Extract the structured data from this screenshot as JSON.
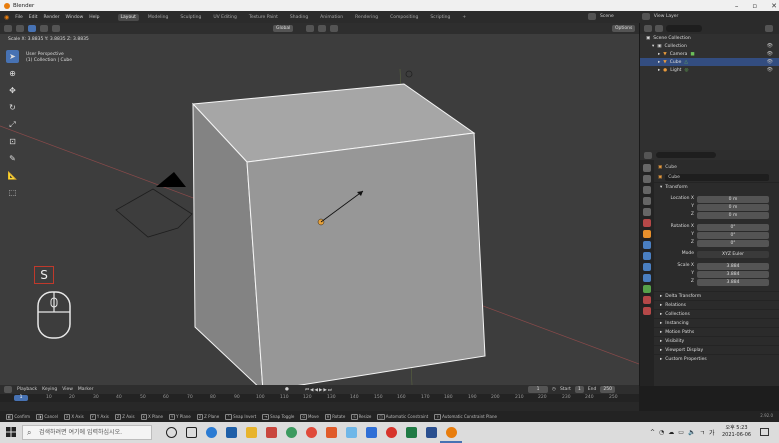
{
  "window": {
    "title": "Blender"
  },
  "menubar": {
    "menus": [
      "File",
      "Edit",
      "Render",
      "Window",
      "Help"
    ],
    "workspaces": [
      "Layout",
      "Modeling",
      "Sculpting",
      "UV Editing",
      "Texture Paint",
      "Shading",
      "Animation",
      "Rendering",
      "Compositing",
      "Scripting"
    ],
    "add_tab": "+",
    "scene_label": "Scene",
    "view_layer_label": "View Layer"
  },
  "viewport": {
    "header": {
      "transform_orientation": "Global",
      "options_label": "Options"
    },
    "operator_info": "Scale X: 3.8835  Y: 3.8835  Z: 3.8835",
    "view_name": "User Perspective",
    "collection_info": "(1) Collection | Cube",
    "key_overlay": "S"
  },
  "outliner": {
    "items": [
      {
        "label": "Scene Collection",
        "level": 0
      },
      {
        "label": "Collection",
        "level": 1
      },
      {
        "label": "Camera",
        "level": 2
      },
      {
        "label": "Cube",
        "level": 2
      },
      {
        "label": "Light",
        "level": 2
      }
    ]
  },
  "properties": {
    "object_name": "Cube",
    "object_field": "Cube",
    "transform_header": "Transform",
    "location": {
      "label": "Location X",
      "x": "0 m",
      "y": "0 m",
      "z": "0 m"
    },
    "rotation": {
      "label": "Rotation X",
      "x": "0°",
      "y": "0°",
      "z": "0°"
    },
    "mode": {
      "label": "Mode",
      "value": "XYZ Euler"
    },
    "scale": {
      "label": "Scale X",
      "x": "3.884",
      "y": "3.884",
      "z": "3.884"
    },
    "axis_labels": {
      "y": "Y",
      "z": "Z"
    },
    "panels": [
      "Delta Transform",
      "Relations",
      "Collections",
      "Instancing",
      "Motion Paths",
      "Visibility",
      "Viewport Display",
      "Custom Properties"
    ]
  },
  "timeline": {
    "menus": [
      "Playback",
      "Keying",
      "View",
      "Marker"
    ],
    "current_frame": "1",
    "start_label": "Start",
    "start": "1",
    "end_label": "End",
    "end": "250",
    "ruler": [
      "10",
      "20",
      "30",
      "40",
      "50",
      "60",
      "70",
      "80",
      "90",
      "100",
      "110",
      "120",
      "130",
      "140",
      "150",
      "160",
      "170",
      "180",
      "190",
      "200",
      "210",
      "220",
      "230",
      "240",
      "250"
    ]
  },
  "statusbar": {
    "items": [
      {
        "key": "",
        "label": "Confirm"
      },
      {
        "key": "",
        "label": "Cancel"
      },
      {
        "key": "X",
        "label": "X Axis"
      },
      {
        "key": "Y",
        "label": "Y Axis"
      },
      {
        "key": "Z",
        "label": "Z Axis"
      },
      {
        "key": "X",
        "label": "X Plane"
      },
      {
        "key": "Y",
        "label": "Y Plane"
      },
      {
        "key": "Z",
        "label": "Z Plane"
      },
      {
        "key": "",
        "label": "Snap Invert"
      },
      {
        "key": "",
        "label": "Snap Toggle"
      },
      {
        "key": "G",
        "label": "Move"
      },
      {
        "key": "R",
        "label": "Rotate"
      },
      {
        "key": "S",
        "label": "Resize"
      },
      {
        "key": "",
        "label": "Automatic Constraint"
      },
      {
        "key": "",
        "label": "Automatic Constraint Plane"
      }
    ],
    "version": "2.92.0"
  },
  "taskbar": {
    "search_placeholder": "검색하려면 여기에 입력하십시오.",
    "time": "오후 5:23",
    "date": "2021-06-06"
  },
  "colors": {
    "accent": "#4772b3",
    "selection": "#334d80",
    "blender_orange": "#e87d0d",
    "key_outline": "#c0392b"
  }
}
